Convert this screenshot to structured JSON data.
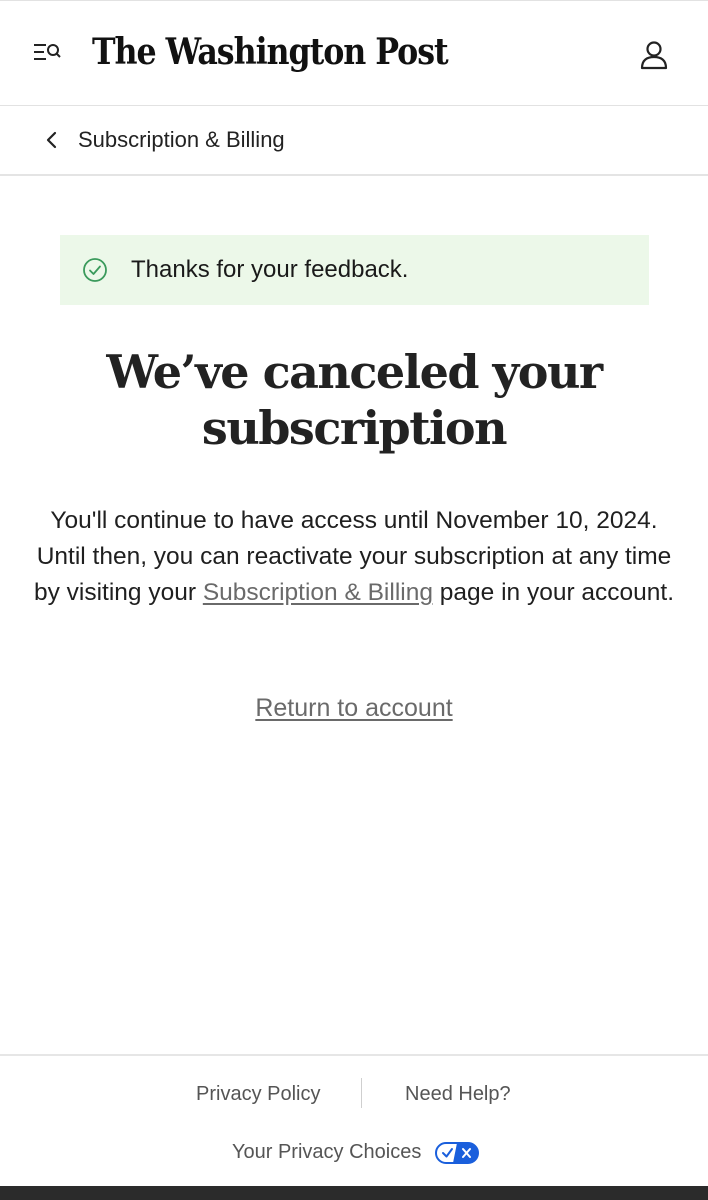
{
  "header": {
    "logo_text": "The Washington Post",
    "menu_icon": "menu-search-icon",
    "account_icon": "user-icon"
  },
  "subnav": {
    "back_icon": "chevron-left-icon",
    "label": "Subscription & Billing"
  },
  "alert": {
    "icon": "check-circle-icon",
    "message": "Thanks for your feedback.",
    "background": "#ecf8e9",
    "icon_color": "#3a9a5b"
  },
  "main": {
    "headline_line1": "We’ve canceled your",
    "headline_line2": "subscription",
    "body_before_link": "You'll continue to have access until November 10, 2024. Until then, you can reactivate your subscription at any time by visiting your ",
    "body_link": "Subscription & Billing",
    "body_after_link": " page in your account.",
    "return_link": "Return to account"
  },
  "footer": {
    "privacy_policy": "Privacy Policy",
    "need_help": "Need Help?",
    "privacy_choices": "Your Privacy Choices",
    "privacy_choices_icon": "privacy-options-toggle-icon",
    "toggle_color": "#1a5fdc"
  }
}
